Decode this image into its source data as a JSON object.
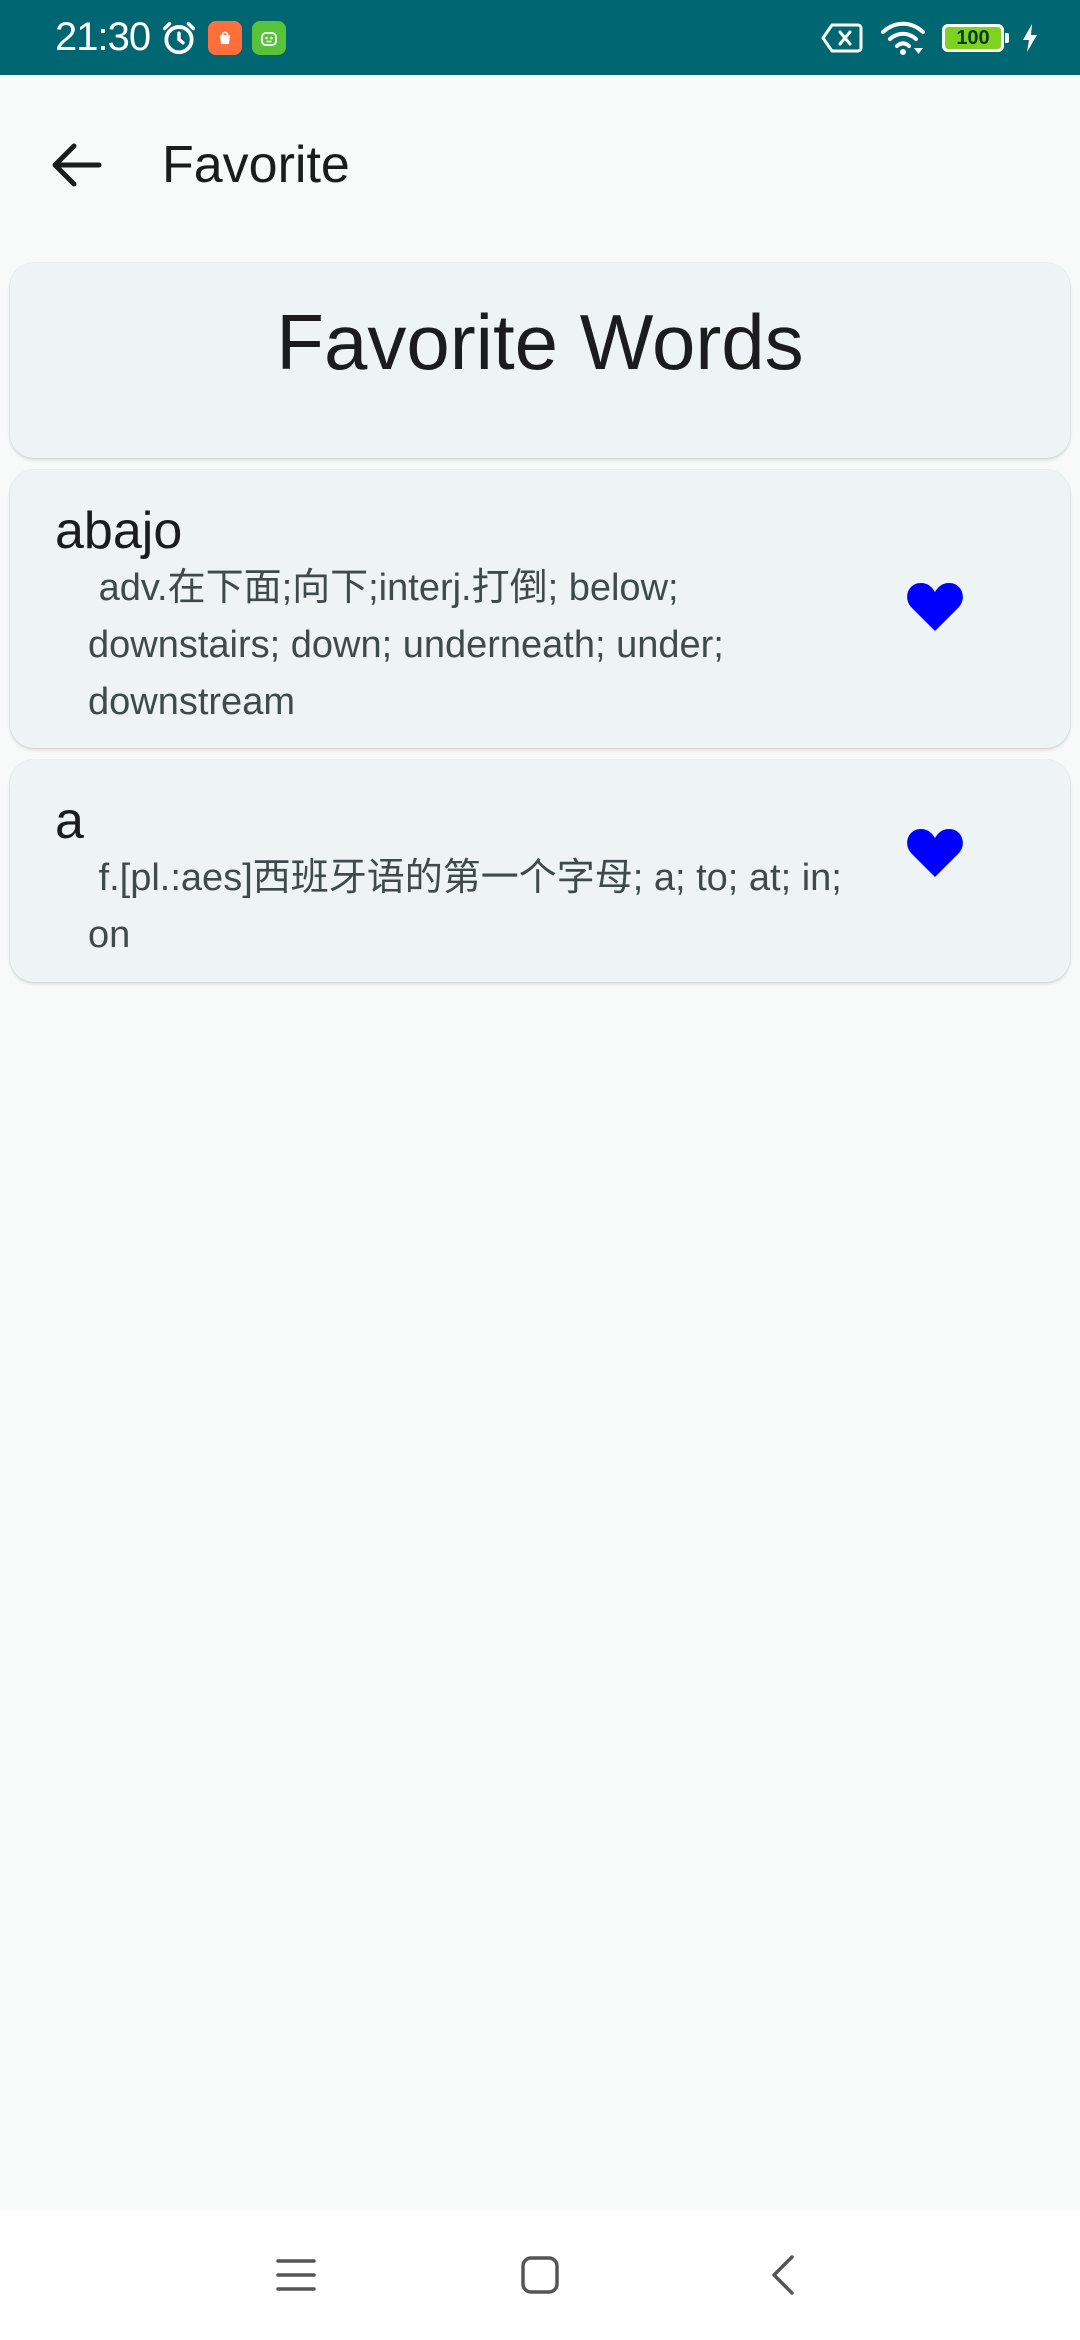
{
  "status_bar": {
    "time": "21:30",
    "battery": "100",
    "icons": [
      "alarm-icon",
      "shop-app-icon",
      "android-app-icon",
      "no-sim-icon",
      "wifi-icon",
      "battery-icon",
      "charging-icon"
    ]
  },
  "app_bar": {
    "title": "Favorite",
    "back_icon": "arrow-left-icon"
  },
  "header": {
    "title": "Favorite Words"
  },
  "words": [
    {
      "word": "abajo",
      "definition": " adv.在下面;向下;interj.打倒; below; downstairs; down; underneath; under; downstream",
      "favorite_icon": "heart-icon"
    },
    {
      "word": "a",
      "definition": " f.[pl.:aes]西班牙语的第一个字母; a; to; at; in; on",
      "favorite_icon": "heart-icon"
    }
  ],
  "nav_bar": {
    "icons": [
      "menu-icon",
      "home-icon",
      "back-icon"
    ]
  },
  "colors": {
    "status_bar": "#006672",
    "background": "#f8fafa",
    "card": "#eef4f4",
    "heart": "#0000ff"
  }
}
